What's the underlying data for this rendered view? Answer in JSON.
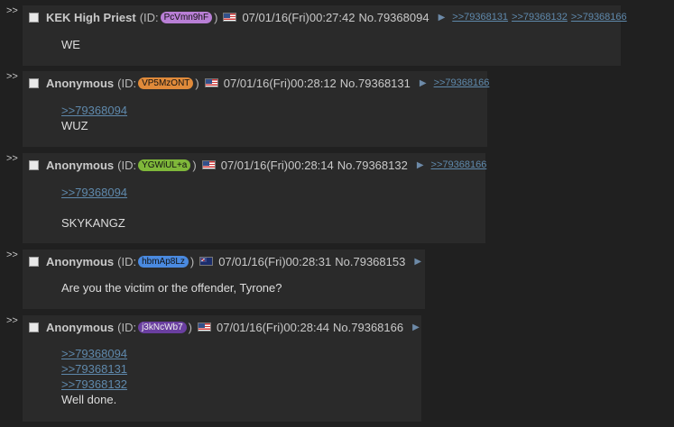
{
  "posts": [
    {
      "name": "KEK High Priest",
      "id_label": "(ID:",
      "id": "PcVmn9hF",
      "id_color": "#b97fd6",
      "id_close": ")",
      "flag": "us-flag-icon",
      "datetime": "07/01/16(Fri)00:27:42",
      "number": "No.79368094",
      "backlinks": [
        ">>79368131",
        ">>79368132",
        ">>79368166"
      ],
      "quotes": [],
      "lines": [
        "WE"
      ]
    },
    {
      "name": "Anonymous",
      "id_label": "(ID:",
      "id": "VP5MzONT",
      "id_color": "#e08a3a",
      "id_close": ")",
      "flag": "us-flag-icon",
      "datetime": "07/01/16(Fri)00:28:12",
      "number": "No.79368131",
      "backlinks": [
        ">>79368166"
      ],
      "quotes": [
        ">>79368094"
      ],
      "lines": [
        "WUZ"
      ]
    },
    {
      "name": "Anonymous",
      "id_label": "(ID:",
      "id": "YGWiUL+a",
      "id_color": "#7fb73a",
      "id_close": ")",
      "flag": "us-flag-icon",
      "datetime": "07/01/16(Fri)00:28:14",
      "number": "No.79368132",
      "backlinks": [
        ">>79368166"
      ],
      "quotes": [
        ">>79368094"
      ],
      "lines": [
        "SKYKANGZ"
      ]
    },
    {
      "name": "Anonymous",
      "id_label": "(ID:",
      "id": "hbmAp8Lz",
      "id_color": "#4a8ae0",
      "id_close": ")",
      "flag": "au-flag-icon",
      "datetime": "07/01/16(Fri)00:28:31",
      "number": "No.79368153",
      "backlinks": [],
      "quotes": [],
      "lines": [
        "Are you the victim or the offender, Tyrone?"
      ]
    },
    {
      "name": "Anonymous",
      "id_label": "(ID:",
      "id": "j3kNcWb7",
      "id_color": "#6a3fa0",
      "id_close": ")",
      "flag": "us-flag-icon",
      "datetime": "07/01/16(Fri)00:28:44",
      "number": "No.79368166",
      "backlinks": [],
      "quotes": [
        ">>79368094",
        ">>79368131",
        ">>79368132"
      ],
      "lines": [
        "Well done."
      ]
    }
  ],
  "ui": {
    "side_arrows": ">>",
    "menu_glyph": "▶"
  }
}
